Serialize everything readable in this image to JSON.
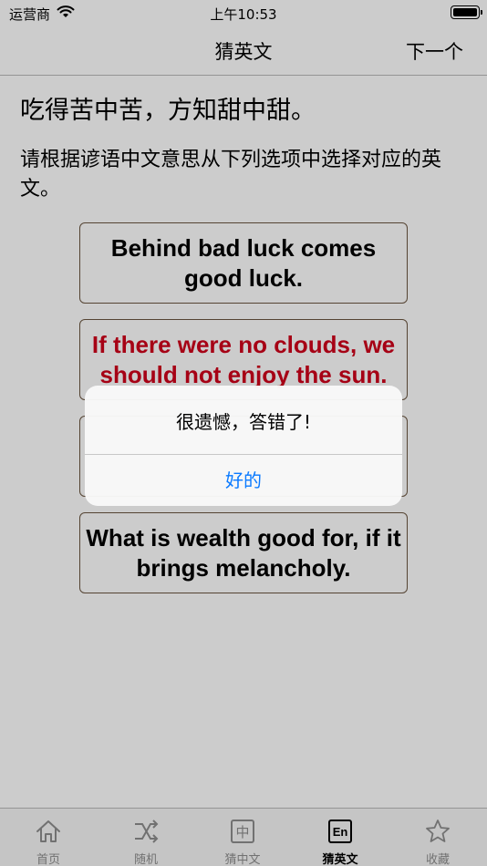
{
  "status_bar": {
    "carrier": "运营商",
    "time": "上午10:53"
  },
  "nav": {
    "title": "猜英文",
    "next_label": "下一个"
  },
  "question": {
    "proverb": "吃得苦中苦，方知甜中甜。",
    "instruction": "请根据谚语中文意思从下列选项中选择对应的英文。"
  },
  "options": [
    {
      "text": "Behind bad luck comes good luck."
    },
    {
      "text": "If there were no clouds, we should not enjoy the sun."
    },
    {
      "text": ""
    },
    {
      "text": "What is wealth good for, if it brings melancholy."
    }
  ],
  "alert": {
    "message": "很遗憾，答错了!",
    "button": "好的"
  },
  "tabs": [
    {
      "label": "首页",
      "icon": "home-icon"
    },
    {
      "label": "随机",
      "icon": "shuffle-icon"
    },
    {
      "label": "猜中文",
      "icon": "zhong-box-icon",
      "glyph": "中"
    },
    {
      "label": "猜英文",
      "icon": "en-box-icon",
      "glyph": "En",
      "active": true
    },
    {
      "label": "收藏",
      "icon": "star-icon"
    }
  ],
  "colors": {
    "wrong_answer": "#d0021b",
    "alert_button": "#0a7aff",
    "option_border": "#6b5640"
  }
}
